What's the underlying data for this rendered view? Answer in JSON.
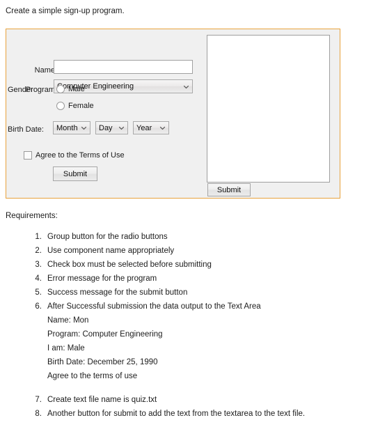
{
  "intro": "Create a simple sign-up program.",
  "form": {
    "name": {
      "label": "Name",
      "value": "",
      "placeholder": ""
    },
    "program": {
      "label": "Program",
      "selected": "Computer Engineering"
    },
    "gender": {
      "label": "Gender",
      "options": [
        "Male",
        "Female"
      ]
    },
    "birth_date": {
      "label": "Birth Date:",
      "month": "Month",
      "day": "Day",
      "year": "Year"
    },
    "agree": {
      "label": "Agree to the Terms of Use",
      "checked": false
    },
    "submit_label": "Submit",
    "textarea": {
      "value": "",
      "placeholder": ""
    },
    "textarea_submit_label": "Submit"
  },
  "requirements": {
    "title": "Requirements:",
    "items": [
      {
        "num": "1.",
        "text": "Group button for the radio buttons",
        "sub": []
      },
      {
        "num": "2.",
        "text": "Use component name appropriately",
        "sub": []
      },
      {
        "num": "3.",
        "text": "Check box must be selected before submitting",
        "sub": []
      },
      {
        "num": "4.",
        "text": "Error message for the program",
        "sub": []
      },
      {
        "num": "5.",
        "text": "Success message for the submit button",
        "sub": []
      },
      {
        "num": "6.",
        "text": "After Successful submission the data output to the Text Area",
        "sub": [
          "Name: Mon",
          "Program: Computer Engineering",
          "I am: Male",
          "Birth Date: December 25, 1990",
          "Agree to the terms of use"
        ]
      },
      {
        "num": "7.",
        "text": "Create text file name is quiz.txt",
        "sub": []
      },
      {
        "num": "8.",
        "text": "Another button for submit to add the text from the textarea to the text file.",
        "sub": []
      }
    ]
  },
  "colors": {
    "panel_border": "#e8a33d",
    "panel_background": "#f0f0f0",
    "page_background": "#ffffff",
    "text": "#1c1c1c"
  }
}
